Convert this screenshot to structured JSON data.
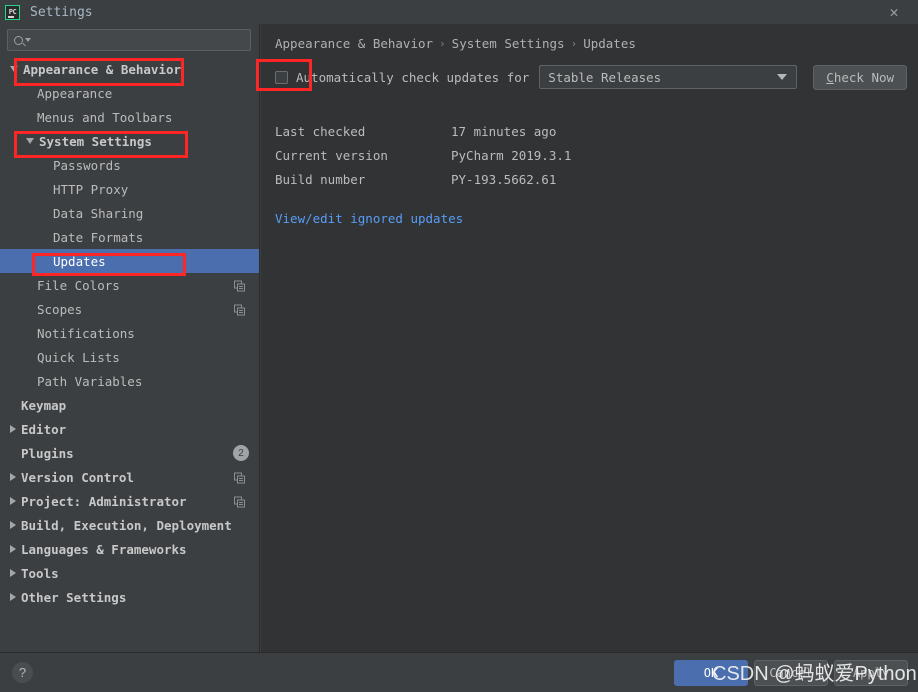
{
  "window": {
    "title": "Settings",
    "app_icon": "pycharm-icon",
    "close_icon": "close-icon"
  },
  "sidebar": {
    "search": {
      "placeholder": "",
      "value": "",
      "icon": "search-icon",
      "caret_icon": "chevron-down-icon"
    },
    "items": [
      {
        "label": "Appearance & Behavior",
        "indent": 0,
        "arrow": "down",
        "bold": true,
        "selected": false,
        "annotated": true
      },
      {
        "label": "Appearance",
        "indent": 1,
        "arrow": "none",
        "bold": false,
        "selected": false
      },
      {
        "label": "Menus and Toolbars",
        "indent": 1,
        "arrow": "none",
        "bold": false,
        "selected": false
      },
      {
        "label": "System Settings",
        "indent": 1,
        "arrow": "down",
        "bold": true,
        "selected": false,
        "annotated": true
      },
      {
        "label": "Passwords",
        "indent": 2,
        "arrow": "none",
        "bold": false,
        "selected": false
      },
      {
        "label": "HTTP Proxy",
        "indent": 2,
        "arrow": "none",
        "bold": false,
        "selected": false
      },
      {
        "label": "Data Sharing",
        "indent": 2,
        "arrow": "none",
        "bold": false,
        "selected": false
      },
      {
        "label": "Date Formats",
        "indent": 2,
        "arrow": "none",
        "bold": false,
        "selected": false
      },
      {
        "label": "Updates",
        "indent": 2,
        "arrow": "none",
        "bold": false,
        "selected": true,
        "annotated": true
      },
      {
        "label": "File Colors",
        "indent": 1,
        "arrow": "none",
        "bold": false,
        "selected": false,
        "badge_icon": "copy-icon"
      },
      {
        "label": "Scopes",
        "indent": 1,
        "arrow": "none",
        "bold": false,
        "selected": false,
        "badge_icon": "copy-icon"
      },
      {
        "label": "Notifications",
        "indent": 1,
        "arrow": "none",
        "bold": false,
        "selected": false
      },
      {
        "label": "Quick Lists",
        "indent": 1,
        "arrow": "none",
        "bold": false,
        "selected": false
      },
      {
        "label": "Path Variables",
        "indent": 1,
        "arrow": "none",
        "bold": false,
        "selected": false
      },
      {
        "label": "Keymap",
        "indent": 0,
        "arrow": "none",
        "bold": true,
        "selected": false
      },
      {
        "label": "Editor",
        "indent": 0,
        "arrow": "right",
        "bold": true,
        "selected": false
      },
      {
        "label": "Plugins",
        "indent": 0,
        "arrow": "none",
        "bold": true,
        "selected": false,
        "count_badge": "2"
      },
      {
        "label": "Version Control",
        "indent": 0,
        "arrow": "right",
        "bold": true,
        "selected": false,
        "badge_icon": "copy-icon"
      },
      {
        "label": "Project: Administrator",
        "indent": 0,
        "arrow": "right",
        "bold": true,
        "selected": false,
        "badge_icon": "copy-icon"
      },
      {
        "label": "Build, Execution, Deployment",
        "indent": 0,
        "arrow": "right",
        "bold": true,
        "selected": false
      },
      {
        "label": "Languages & Frameworks",
        "indent": 0,
        "arrow": "right",
        "bold": true,
        "selected": false
      },
      {
        "label": "Tools",
        "indent": 0,
        "arrow": "right",
        "bold": true,
        "selected": false
      },
      {
        "label": "Other Settings",
        "indent": 0,
        "arrow": "right",
        "bold": true,
        "selected": false
      }
    ]
  },
  "breadcrumb": {
    "part1": "Appearance & Behavior",
    "sep1": "›",
    "part2": "System Settings",
    "sep2": "›",
    "part3": "Updates"
  },
  "updates": {
    "auto_check_label": "Automatically check updates for",
    "auto_check_checked": false,
    "channel_selected": "Stable Releases",
    "channel_caret_icon": "chevron-down-icon",
    "check_now_mnemonic": "C",
    "check_now_rest": "heck Now",
    "info": [
      {
        "key": "Last checked",
        "value": "17 minutes ago"
      },
      {
        "key": "Current version",
        "value": "PyCharm 2019.3.1"
      },
      {
        "key": "Build number",
        "value": "PY-193.5662.61"
      }
    ],
    "ignored_link": "View/edit ignored updates"
  },
  "footer": {
    "help_label": "?",
    "ok": "OK",
    "cancel": "Cancel",
    "apply": "Apply"
  },
  "watermark": {
    "text": "CSDN @蚂蚁爱Python"
  },
  "colors": {
    "accent": "#4b6eaf",
    "link": "#589df6",
    "annotation": "#ff2626",
    "sidebar_bg": "#3c3f41",
    "content_bg": "#313335",
    "text": "#bbbbbb"
  }
}
